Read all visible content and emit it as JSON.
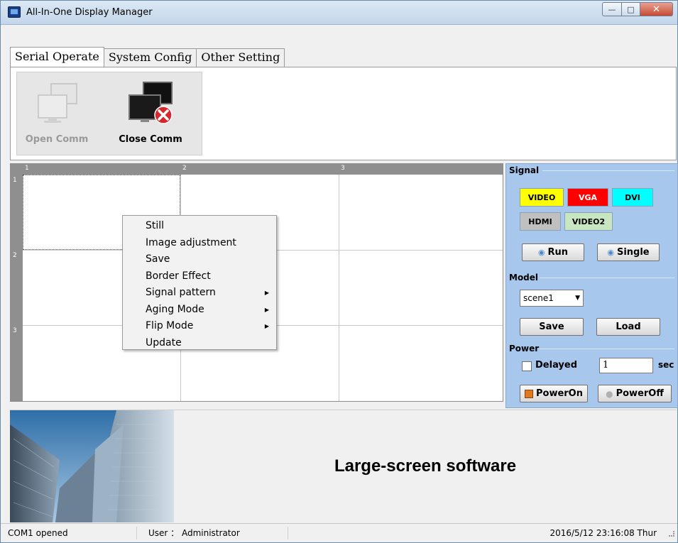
{
  "window": {
    "title": "All-In-One Display Manager"
  },
  "tabs": [
    {
      "label": "Serial Operate",
      "active": true
    },
    {
      "label": "System Config",
      "active": false
    },
    {
      "label": "Other Setting",
      "active": false
    }
  ],
  "comm": {
    "open_label": "Open Comm",
    "close_label": "Close Comm"
  },
  "grid": {
    "columns": [
      "1",
      "2",
      "3"
    ],
    "rows": [
      "1",
      "2",
      "3"
    ]
  },
  "context_menu": {
    "items": [
      {
        "label": "Still",
        "submenu": false
      },
      {
        "label": "Image adjustment",
        "submenu": false
      },
      {
        "label": "Save",
        "submenu": false
      },
      {
        "label": "Border Effect",
        "submenu": false
      },
      {
        "label": "Signal pattern",
        "submenu": true
      },
      {
        "label": "Aging Mode",
        "submenu": true
      },
      {
        "label": "Flip Mode",
        "submenu": true
      },
      {
        "label": "Update",
        "submenu": false
      }
    ]
  },
  "signal": {
    "title": "Signal",
    "buttons": [
      {
        "label": "VIDEO",
        "color": "#ffff00"
      },
      {
        "label": "VGA",
        "color": "#ff0000"
      },
      {
        "label": "DVI",
        "color": "#00ffff"
      },
      {
        "label": "HDMI",
        "color": "#c0c0c0"
      },
      {
        "label": "VIDEO2",
        "color": "#c7e6c1"
      }
    ],
    "run_label": "Run",
    "single_label": "Single"
  },
  "model": {
    "title": "Model",
    "selected": "scene1",
    "save_label": "Save",
    "load_label": "Load"
  },
  "power": {
    "title": "Power",
    "delayed_label": "Delayed",
    "delay_value": "1",
    "unit": "sec",
    "on_label": "PowerOn",
    "off_label": "PowerOff"
  },
  "banner": {
    "text": "Large-screen software"
  },
  "status": {
    "port": "COM1  opened",
    "user": "User ： Administrator",
    "datetime": "2016/5/12 23:16:08  Thur"
  }
}
